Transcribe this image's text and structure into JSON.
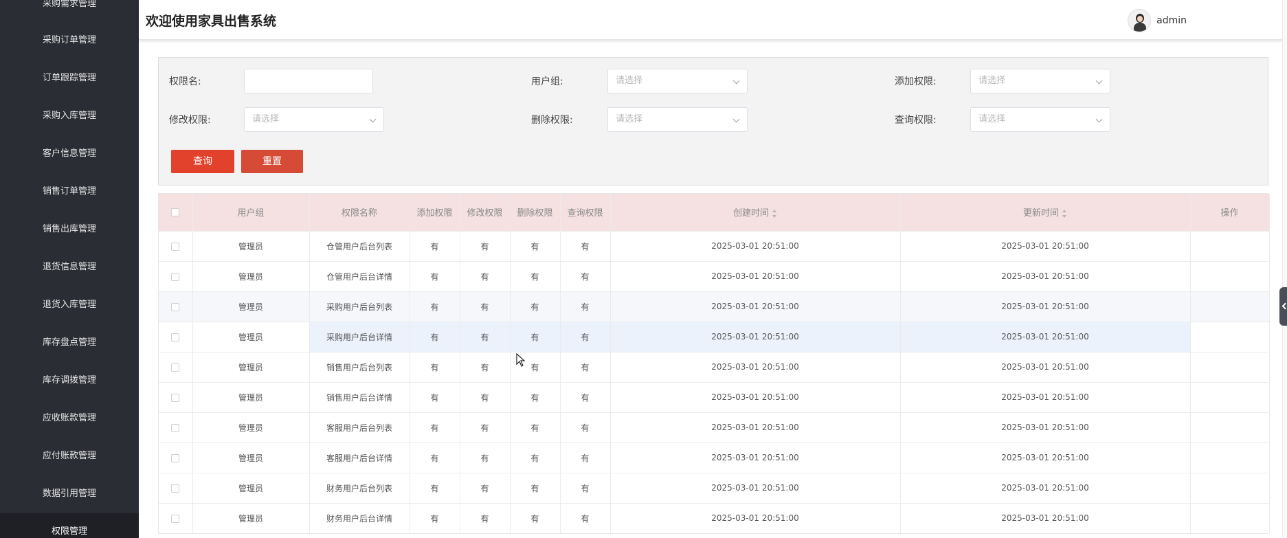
{
  "header": {
    "app_title": "欢迎使用家具出售系统",
    "username": "admin"
  },
  "sidebar": {
    "items": [
      {
        "label": "采购需求管理"
      },
      {
        "label": "采购订单管理"
      },
      {
        "label": "订单跟踪管理"
      },
      {
        "label": "采购入库管理"
      },
      {
        "label": "客户信息管理"
      },
      {
        "label": "销售订单管理"
      },
      {
        "label": "销售出库管理"
      },
      {
        "label": "退货信息管理"
      },
      {
        "label": "退货入库管理"
      },
      {
        "label": "库存盘点管理"
      },
      {
        "label": "库存调拨管理"
      },
      {
        "label": "应收账款管理"
      },
      {
        "label": "应付账款管理"
      },
      {
        "label": "数据引用管理"
      },
      {
        "label": "权限管理",
        "active": true
      }
    ]
  },
  "search": {
    "perm_name_label": "权限名:",
    "perm_name_value": "",
    "user_group_label": "用户组:",
    "add_perm_label": "添加权限:",
    "edit_perm_label": "修改权限:",
    "delete_perm_label": "删除权限:",
    "query_perm_label": "查询权限:",
    "select_placeholder": "请选择",
    "query_button": "查询",
    "reset_button": "重置"
  },
  "table": {
    "columns": [
      "用户组",
      "权限名称",
      "添加权限",
      "修改权限",
      "删除权限",
      "查询权限",
      "创建时间",
      "更新时间",
      "操作"
    ],
    "rows": [
      {
        "group": "管理员",
        "name": "仓管用户后台列表",
        "add": "有",
        "edit": "有",
        "del": "有",
        "query": "有",
        "created": "2025-03-01 20:51:00",
        "updated": "2025-03-01 20:51:00"
      },
      {
        "group": "管理员",
        "name": "仓管用户后台详情",
        "add": "有",
        "edit": "有",
        "del": "有",
        "query": "有",
        "created": "2025-03-01 20:51:00",
        "updated": "2025-03-01 20:51:00"
      },
      {
        "group": "管理员",
        "name": "采购用户后台列表",
        "add": "有",
        "edit": "有",
        "del": "有",
        "query": "有",
        "created": "2025-03-01 20:51:00",
        "updated": "2025-03-01 20:51:00"
      },
      {
        "group": "管理员",
        "name": "采购用户后台详情",
        "add": "有",
        "edit": "有",
        "del": "有",
        "query": "有",
        "created": "2025-03-01 20:51:00",
        "updated": "2025-03-01 20:51:00"
      },
      {
        "group": "管理员",
        "name": "销售用户后台列表",
        "add": "有",
        "edit": "有",
        "del": "有",
        "query": "有",
        "created": "2025-03-01 20:51:00",
        "updated": "2025-03-01 20:51:00"
      },
      {
        "group": "管理员",
        "name": "销售用户后台详情",
        "add": "有",
        "edit": "有",
        "del": "有",
        "query": "有",
        "created": "2025-03-01 20:51:00",
        "updated": "2025-03-01 20:51:00"
      },
      {
        "group": "管理员",
        "name": "客服用户后台列表",
        "add": "有",
        "edit": "有",
        "del": "有",
        "query": "有",
        "created": "2025-03-01 20:51:00",
        "updated": "2025-03-01 20:51:00"
      },
      {
        "group": "管理员",
        "name": "客服用户后台详情",
        "add": "有",
        "edit": "有",
        "del": "有",
        "query": "有",
        "created": "2025-03-01 20:51:00",
        "updated": "2025-03-01 20:51:00"
      },
      {
        "group": "管理员",
        "name": "财务用户后台列表",
        "add": "有",
        "edit": "有",
        "del": "有",
        "query": "有",
        "created": "2025-03-01 20:51:00",
        "updated": "2025-03-01 20:51:00"
      },
      {
        "group": "管理员",
        "name": "财务用户后台详情",
        "add": "有",
        "edit": "有",
        "del": "有",
        "query": "有",
        "created": "2025-03-01 20:51:00",
        "updated": "2025-03-01 20:51:00"
      }
    ]
  },
  "colors": {
    "sidebar_bg": "#2a2d33",
    "primary_button": "#e2422b",
    "table_header_bg": "#f5e1e2"
  }
}
